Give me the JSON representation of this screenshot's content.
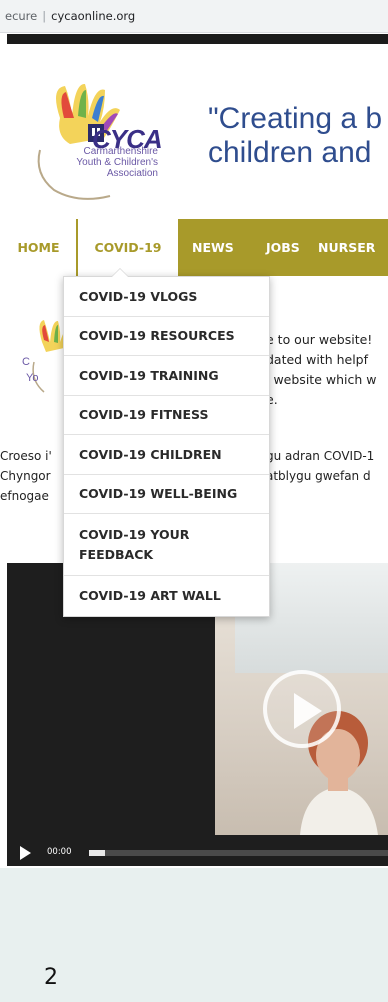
{
  "address_bar": {
    "prefix": "ecure",
    "url": "cycaonline.org"
  },
  "logo": {
    "name": "CYCA",
    "line1": "Carmarthenshire",
    "line2": "Youth & Children's",
    "line3": "Association"
  },
  "tagline": {
    "line1": "\"Creating a b",
    "line2": "children and"
  },
  "nav": {
    "home": "HOME",
    "covid": "COVID-19",
    "news": "NEWS",
    "jobs": "JOBS",
    "nursery": "NURSER",
    "accent_color": "#a89a2a"
  },
  "dropdown": {
    "items": [
      "COVID-19 VLOGS",
      "COVID-19 RESOURCES",
      "COVID-19 TRAINING",
      "COVID-19 FITNESS",
      "COVID-19 CHILDREN",
      "COVID-19 WELL-BEING",
      "COVID-19 YOUR FEEDBACK",
      "COVID-19 ART WALL"
    ]
  },
  "welcome": {
    "line1": "e to our website!",
    "line2": "dated with helpf",
    "line3_link": "l",
    "line3_rest": " website which w",
    "line4": "e."
  },
  "welsh": {
    "left1": "Croeso i'",
    "left2": "Chyngor",
    "left3": "efnogae",
    "right1": "gu adran COVID-1",
    "right2": "atblygu gwefan d"
  },
  "video": {
    "time": "00:00"
  },
  "page_number": "2"
}
